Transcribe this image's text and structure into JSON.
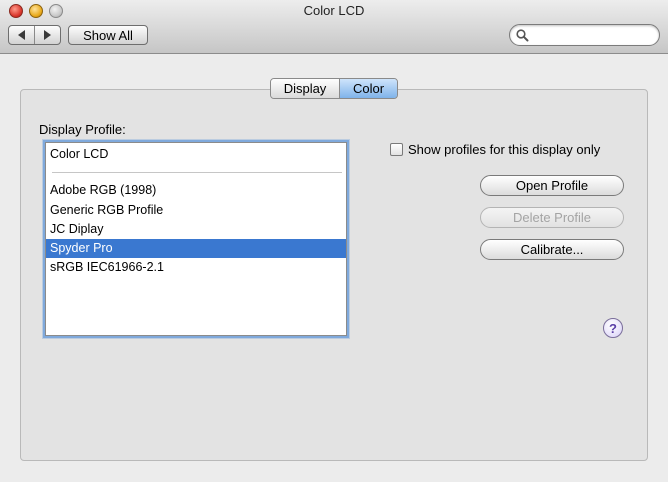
{
  "window": {
    "title": "Color LCD"
  },
  "toolbar": {
    "back_icon": "back-arrow-icon",
    "forward_icon": "forward-arrow-icon",
    "show_all_label": "Show All",
    "search": {
      "value": "",
      "placeholder": "",
      "icon": "search-icon"
    }
  },
  "tabs": [
    {
      "label": "Display",
      "selected": false
    },
    {
      "label": "Color",
      "selected": true
    }
  ],
  "profiles": {
    "label": "Display Profile:",
    "items": [
      {
        "label": "Color LCD",
        "selected": false
      },
      {
        "label": "Adobe RGB (1998)",
        "selected": false
      },
      {
        "label": "Generic RGB Profile",
        "selected": false
      },
      {
        "label": "JC Diplay",
        "selected": false
      },
      {
        "label": "Spyder Pro",
        "selected": true
      },
      {
        "label": "sRGB IEC61966-2.1",
        "selected": false
      }
    ],
    "selection_color": "#3a78d0"
  },
  "options": {
    "show_only_label": "Show profiles for this display only",
    "show_only_checked": false
  },
  "buttons": {
    "open_profile": "Open Profile",
    "delete_profile": "Delete Profile",
    "calibrate": "Calibrate..."
  },
  "help": {
    "label": "?",
    "icon": "help-icon"
  }
}
